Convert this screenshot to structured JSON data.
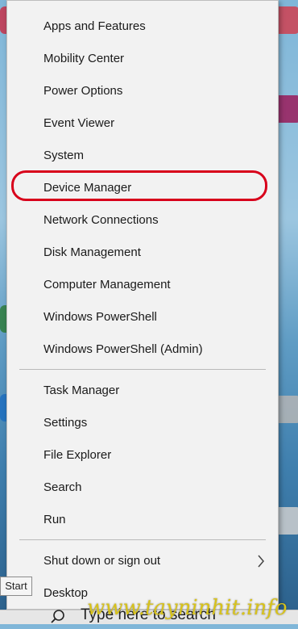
{
  "menu": {
    "items": [
      {
        "label": "Apps and Features"
      },
      {
        "label": "Mobility Center"
      },
      {
        "label": "Power Options"
      },
      {
        "label": "Event Viewer"
      },
      {
        "label": "System"
      },
      {
        "label": "Device Manager",
        "highlighted": true
      },
      {
        "label": "Network Connections"
      },
      {
        "label": "Disk Management"
      },
      {
        "label": "Computer Management"
      },
      {
        "label": "Windows PowerShell"
      },
      {
        "label": "Windows PowerShell (Admin)"
      },
      {
        "label": "Task Manager"
      },
      {
        "label": "Settings"
      },
      {
        "label": "File Explorer"
      },
      {
        "label": "Search"
      },
      {
        "label": "Run"
      },
      {
        "label": "Shut down or sign out",
        "has_submenu": true
      },
      {
        "label": "Desktop"
      }
    ],
    "highlight_color": "#d8001b"
  },
  "tooltip": {
    "text": "Start"
  },
  "taskbar": {
    "search_placeholder": "Type here to search"
  },
  "watermark": {
    "text": "www.tayninhit.info",
    "color": "#d7c21c"
  }
}
